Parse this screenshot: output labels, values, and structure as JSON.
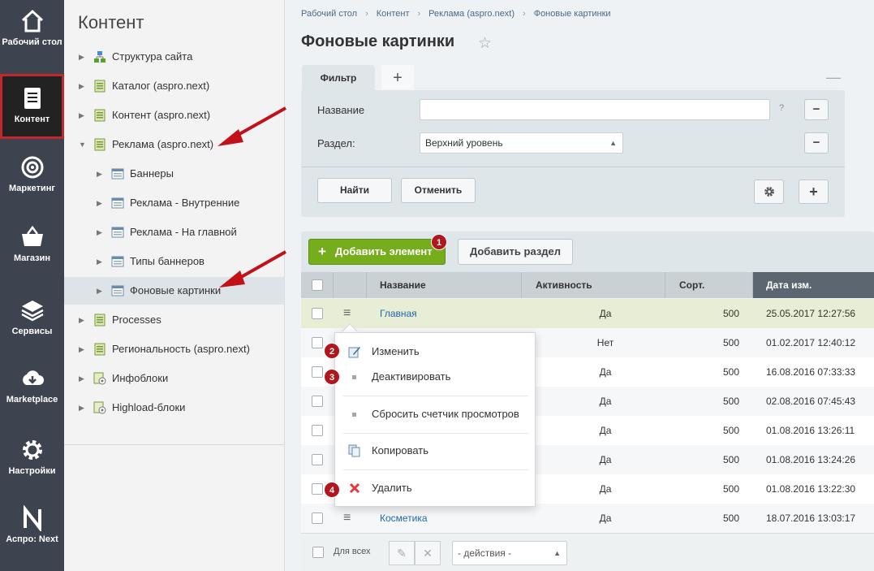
{
  "leftnav": {
    "items": [
      {
        "label": "Рабочий стол",
        "icon": "home-icon"
      },
      {
        "label": "Контент",
        "icon": "document-icon",
        "active": true
      },
      {
        "label": "Маркетинг",
        "icon": "target-icon"
      },
      {
        "label": "Магазин",
        "icon": "basket-icon"
      },
      {
        "label": "Сервисы",
        "icon": "layers-icon"
      },
      {
        "label": "Marketplace",
        "icon": "cloud-download-icon"
      },
      {
        "label": "Настройки",
        "icon": "gear-icon"
      },
      {
        "label": "Аспро: Next",
        "icon": "aspro-logo-icon"
      }
    ]
  },
  "tree": {
    "title": "Контент",
    "items": [
      {
        "label": "Структура сайта",
        "level": 0,
        "expanded": false
      },
      {
        "label": "Каталог (aspro.next)",
        "level": 0,
        "expanded": false
      },
      {
        "label": "Контент (aspro.next)",
        "level": 0,
        "expanded": false
      },
      {
        "label": "Реклама (aspro.next)",
        "level": 0,
        "expanded": true
      },
      {
        "label": "Баннеры",
        "level": 1
      },
      {
        "label": "Реклама - Внутренние",
        "level": 1
      },
      {
        "label": "Реклама - На главной",
        "level": 1
      },
      {
        "label": "Типы баннеров",
        "level": 1
      },
      {
        "label": "Фоновые картинки",
        "level": 1,
        "selected": true
      },
      {
        "label": "Processes",
        "level": 0
      },
      {
        "label": "Региональность (aspro.next)",
        "level": 0
      },
      {
        "label": "Инфоблоки",
        "level": 0
      },
      {
        "label": "Highload-блоки",
        "level": 0
      }
    ]
  },
  "breadcrumbs": [
    "Рабочий стол",
    "Контент",
    "Реклама (aspro.next)",
    "Фоновые картинки"
  ],
  "page_title": "Фоновые картинки",
  "filter": {
    "tab_label": "Фильтр",
    "plus": "+",
    "minimize": "—",
    "name_label": "Название",
    "name_value": "",
    "help": "?",
    "section_label": "Раздел:",
    "section_value": "Верхний уровень",
    "find_label": "Найти",
    "cancel_label": "Отменить",
    "remove_sign": "−"
  },
  "toolbar": {
    "add_element": "Добавить элемент",
    "add_section": "Добавить раздел"
  },
  "table": {
    "columns": [
      "Название",
      "Активность",
      "Сорт.",
      "Дата изм."
    ],
    "rows": [
      {
        "name": "Главная",
        "active": "Да",
        "sort": "500",
        "date": "25.05.2017 12:27:56"
      },
      {
        "name": "",
        "active": "Нет",
        "sort": "500",
        "date": "01.02.2017 12:40:12"
      },
      {
        "name": "",
        "active": "Да",
        "sort": "500",
        "date": "16.08.2016 07:33:33"
      },
      {
        "name": "",
        "active": "Да",
        "sort": "500",
        "date": "02.08.2016 07:45:43"
      },
      {
        "name": "",
        "active": "Да",
        "sort": "500",
        "date": "01.08.2016 13:26:11"
      },
      {
        "name": "",
        "active": "Да",
        "sort": "500",
        "date": "01.08.2016 13:24:26"
      },
      {
        "name": "",
        "active": "Да",
        "sort": "500",
        "date": "01.08.2016 13:22:30"
      },
      {
        "name": "Косметика",
        "active": "Да",
        "sort": "500",
        "date": "18.07.2016 13:03:17"
      }
    ]
  },
  "footer": {
    "for_all": "Для всех",
    "actions": "- действия -"
  },
  "context_menu": {
    "items": [
      {
        "label": "Изменить",
        "icon": "edit-icon"
      },
      {
        "label": "Деактивировать",
        "icon": "bullet-icon"
      },
      {
        "label": "Сбросить счетчик просмотров",
        "icon": "bullet-icon"
      },
      {
        "label": "Копировать",
        "icon": "copy-icon"
      },
      {
        "label": "Удалить",
        "icon": "delete-icon"
      }
    ]
  },
  "badges": [
    "1",
    "2",
    "3",
    "4"
  ],
  "colors": {
    "nav_bg": "#3d4450",
    "active_outline": "#c1272d",
    "add_button": "#76ad1c",
    "badge": "#b0161b",
    "link": "#2067b0"
  }
}
